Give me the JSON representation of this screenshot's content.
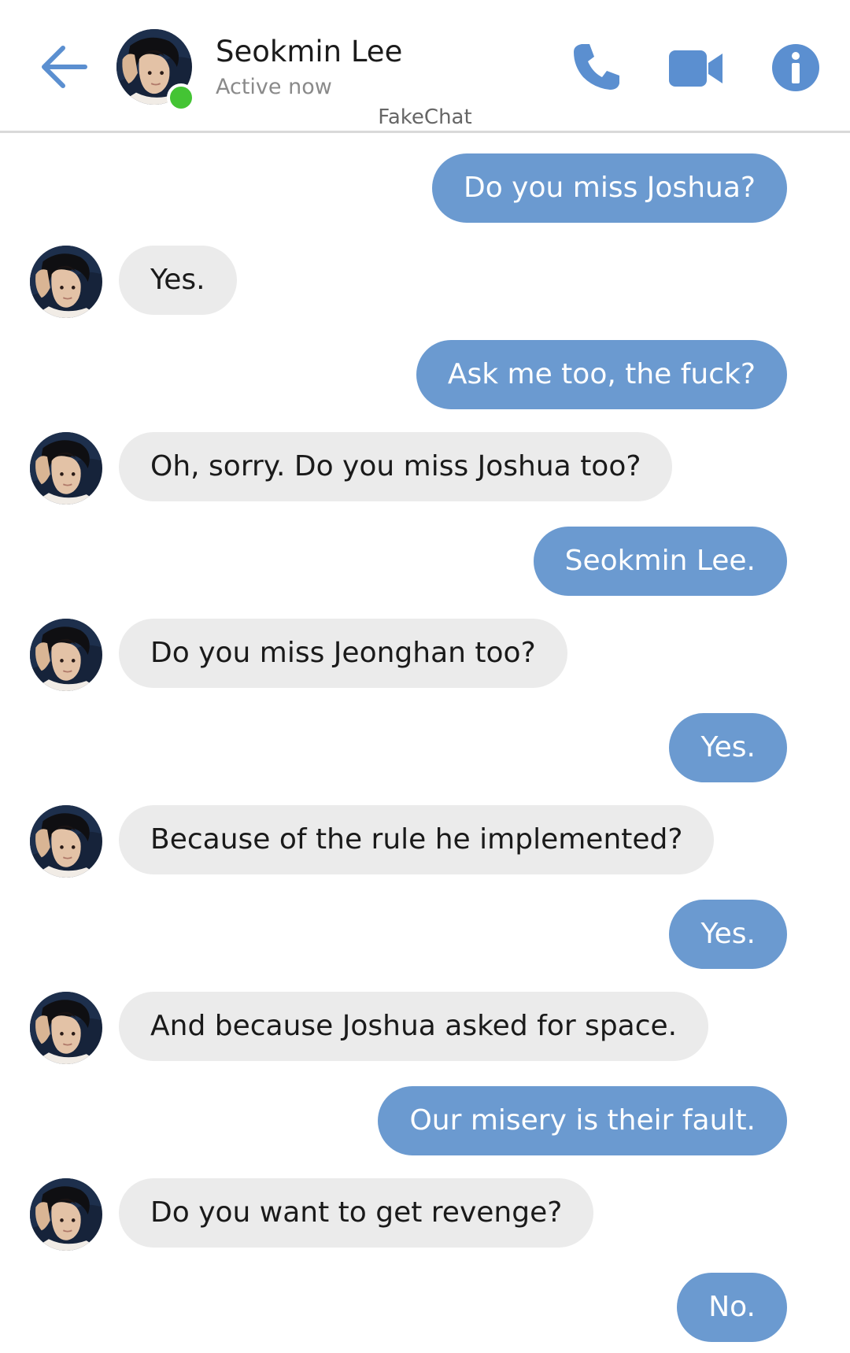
{
  "header": {
    "contact_name": "Seokmin Lee",
    "status": "Active now",
    "watermark": "FakeChat",
    "icons": {
      "back": "arrow-left-icon",
      "call": "phone-icon",
      "video": "video-camera-icon",
      "info": "info-icon"
    },
    "online_indicator_color": "#44c434"
  },
  "colors": {
    "accent": "#6b9ad0",
    "sent_bubble": "#6b9ad0",
    "received_bubble": "#ebebeb",
    "divider": "#d9d9d9"
  },
  "messages": [
    {
      "direction": "sent",
      "text": "Do you miss Joshua?"
    },
    {
      "direction": "received",
      "text": "Yes."
    },
    {
      "direction": "sent",
      "text": "Ask me too, the fuck?"
    },
    {
      "direction": "received",
      "text": "Oh, sorry. Do you miss Joshua too?"
    },
    {
      "direction": "sent",
      "text": "Seokmin Lee."
    },
    {
      "direction": "received",
      "text": "Do you miss Jeonghan too?"
    },
    {
      "direction": "sent",
      "text": "Yes."
    },
    {
      "direction": "received",
      "text": "Because of the rule he implemented?"
    },
    {
      "direction": "sent",
      "text": "Yes."
    },
    {
      "direction": "received",
      "text": "And because Joshua asked for space."
    },
    {
      "direction": "sent",
      "text": "Our misery is their fault."
    },
    {
      "direction": "received",
      "text": "Do you want to get revenge?"
    },
    {
      "direction": "sent",
      "text": "No."
    }
  ]
}
